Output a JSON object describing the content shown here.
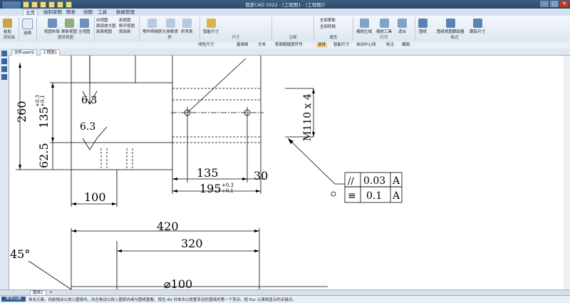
{
  "app": {
    "title": "我爱CAD 2022 - [工程图1 - (工程图)]"
  },
  "window_buttons": [
    "–",
    "□",
    "✕"
  ],
  "tabs": [
    "主页",
    "绘制草图",
    "图表",
    "视图",
    "工具",
    "数据管理"
  ],
  "ribbon": {
    "groups": [
      {
        "label": "剪贴板",
        "buttons": [
          "粘贴"
        ]
      },
      {
        "label": "",
        "buttons": [
          "选择"
        ]
      },
      {
        "label": "图纸视图",
        "buttons": [
          "视图布局",
          "更新视图",
          "主视图"
        ]
      },
      {
        "label": "",
        "buttons": [
          "向视图",
          "局部放大图",
          "剖面视图",
          "剖面图",
          "断开视图",
          "局部剖"
        ]
      },
      {
        "label": "表",
        "buttons": [
          "零件明细表",
          "孔参数表",
          "折弯表"
        ]
      },
      {
        "label": "尺寸",
        "buttons": [
          "智能尺寸"
        ]
      },
      {
        "label": "注释",
        "buttons": []
      },
      {
        "label": "属性",
        "buttons": [
          "全部更新",
          "全部转换"
        ]
      },
      {
        "label": "打印",
        "buttons": [
          "缩放区域",
          "缩放工具",
          "适合"
        ]
      },
      {
        "label": "格式",
        "buttons": [
          "图纸",
          "图纸视图跟踪器",
          "跟踪尺寸"
        ]
      }
    ]
  },
  "cmdbar": {
    "items": [
      "线性尺寸",
      "基准面",
      "文本",
      "表面粗糙度符号",
      "选择",
      "智能尺寸",
      "自动中心线",
      "标注",
      "编辑"
    ]
  },
  "doc_tabs": [
    "文件-part1",
    "工程图1"
  ],
  "sheet_tabs": [
    "图纸1",
    "+"
  ],
  "status": {
    "mode": "单击元素",
    "message": "单击元素。向前拖动以放入图纸内。向左拖动以放入图纸内或与图纸重叠。按住 Alt 并单击以放置多边形图纸的第一个顶点。按 Esc 以清除显示的关键点。"
  },
  "drawing": {
    "dims": {
      "d260": "260",
      "d135": "135",
      "tol135_upper": "+0.3",
      "tol135_lower": "+0.1",
      "d62_5": "62.5",
      "d100": "100",
      "d135h": "135",
      "d30": "30",
      "d195": "195",
      "tol195_upper": "+0.3",
      "tol195_lower": "+0.1",
      "d420": "420",
      "d320": "320",
      "angle": "45°",
      "dia": "⌀100",
      "thread": "M110 x 4"
    },
    "roughness": [
      "6.3",
      "6.3"
    ],
    "gdt": [
      {
        "symbol": "//",
        "value": "0.03",
        "datum": "A"
      },
      {
        "symbol": "≡",
        "value": "0.1",
        "datum": "A"
      }
    ]
  },
  "colors": {
    "titlebar": "#2b4868",
    "accent": "#3b66a0"
  }
}
